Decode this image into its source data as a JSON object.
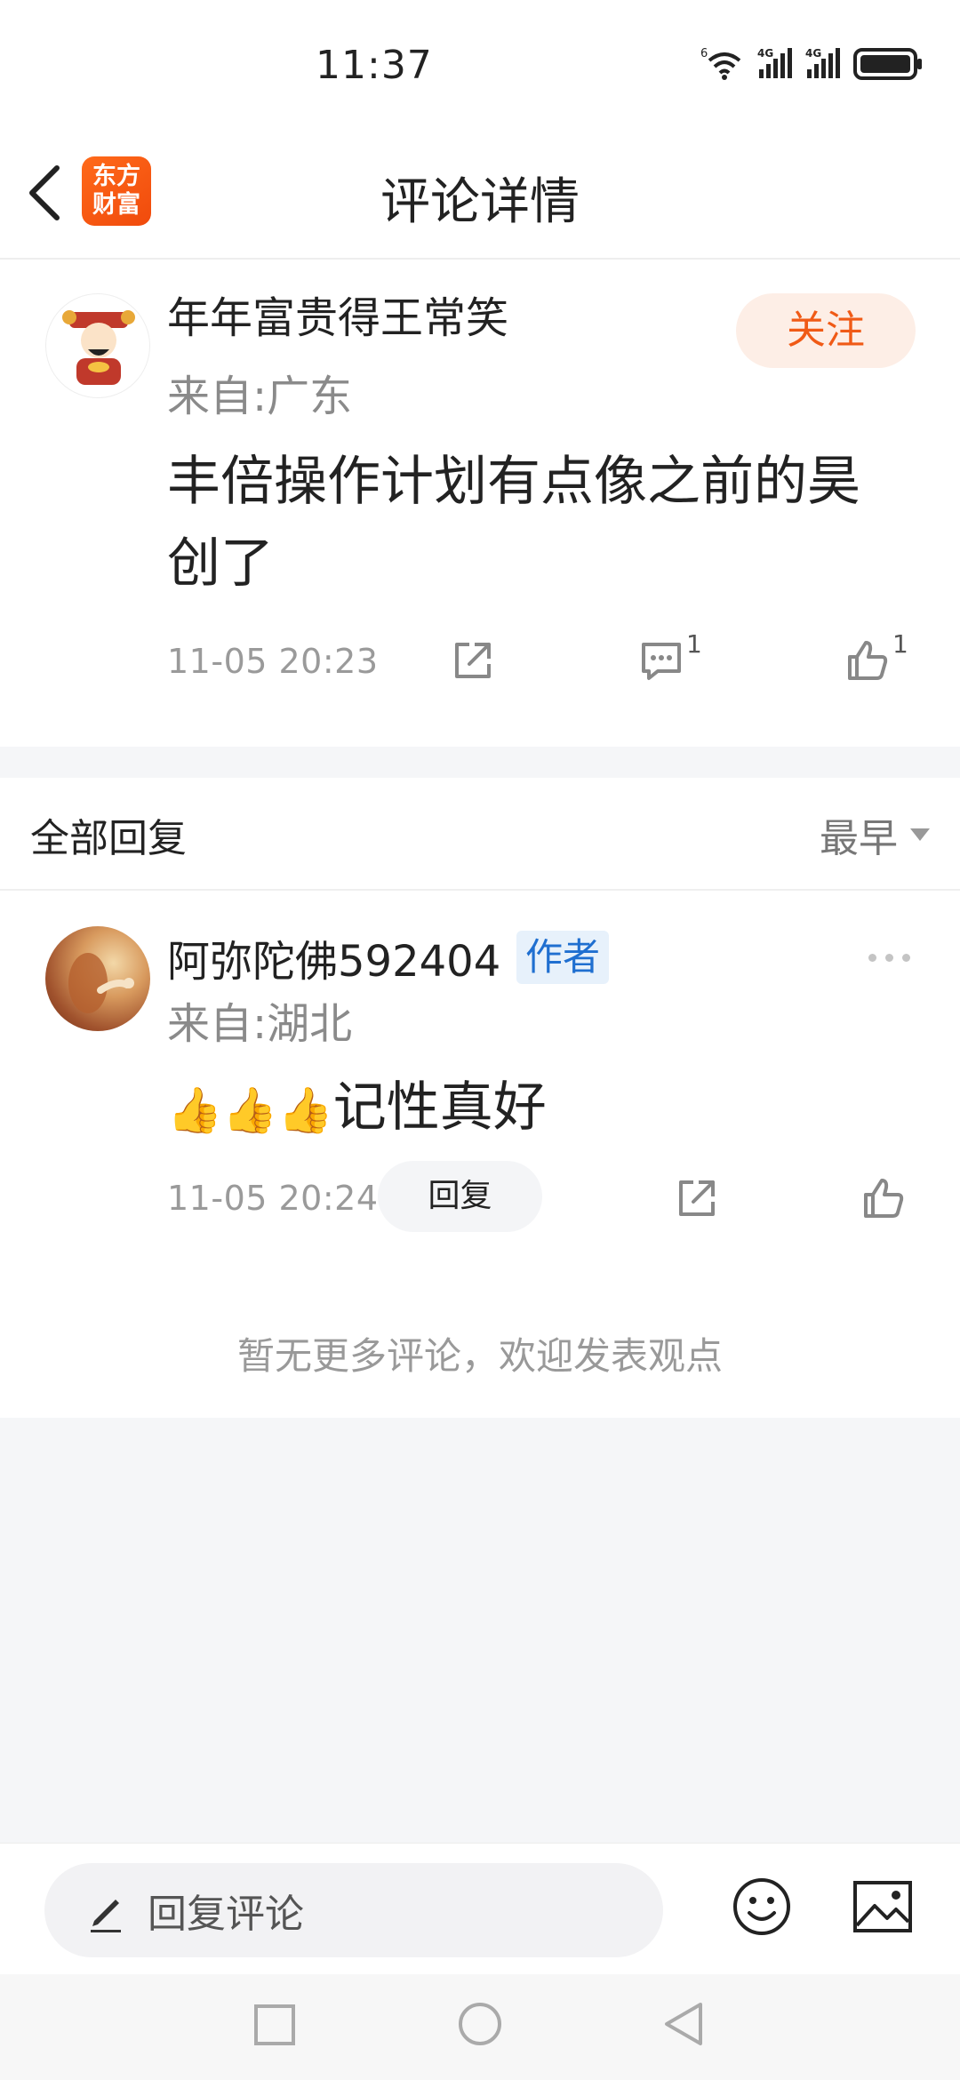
{
  "status_bar": {
    "time": "11:37",
    "network_1": "4G",
    "network_2": "4G",
    "wifi_label": "6"
  },
  "header": {
    "title": "评论详情",
    "logo_line_1": "东方",
    "logo_line_2": "财富"
  },
  "main_comment": {
    "user_name": "年年富贵得王常笑",
    "location": "来自:广东",
    "follow_label": "关注",
    "content": "丰倍操作计划有点像之前的昊创了",
    "timestamp": "11-05 20:23",
    "comment_count": "1",
    "like_count": "1"
  },
  "replies_section": {
    "title": "全部回复",
    "sort_label": "最早"
  },
  "replies": [
    {
      "user_name": "阿弥陀佛592404",
      "badge": "作者",
      "location": "来自:湖北",
      "emoji": "👍👍👍",
      "content": "记性真好",
      "timestamp": "11-05 20:24",
      "reply_label": "回复"
    }
  ],
  "no_more_text": "暂无更多评论，欢迎发表观点",
  "composer": {
    "placeholder": "回复评论"
  },
  "colors": {
    "brand_orange": "#f05a16",
    "author_badge_blue": "#1f6fd0",
    "background_grey": "#f5f6f8"
  },
  "icons": [
    "wifi-icon",
    "signal-icon",
    "battery-icon",
    "back-arrow-icon",
    "share-icon",
    "comment-icon",
    "like-icon",
    "more-dots-icon",
    "pencil-icon",
    "emoji-icon",
    "image-icon",
    "recent-apps-icon",
    "home-icon",
    "back-triangle-icon"
  ]
}
